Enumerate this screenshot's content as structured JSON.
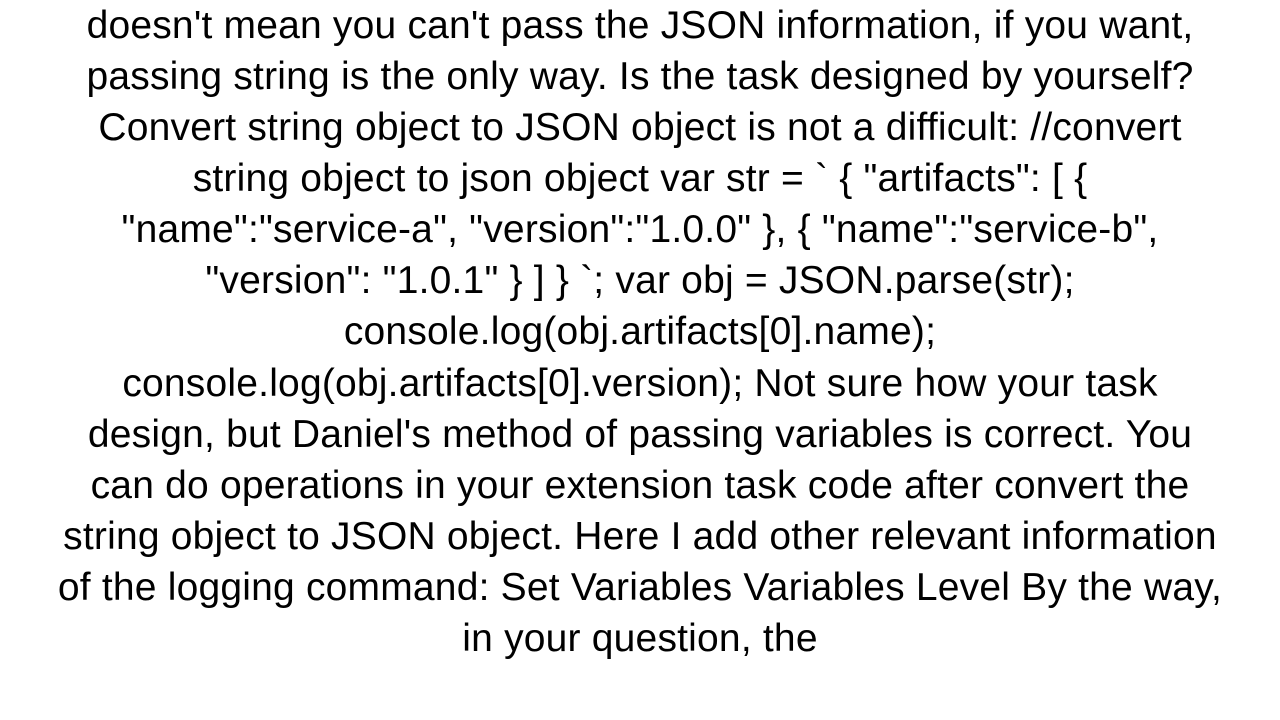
{
  "document": {
    "body_text": "doesn't mean you can't pass the JSON information, if you want, passing string is the only way. Is the task designed by yourself? Convert string object to JSON object is not a difficult: //convert string object to json object  var str = ` { \"artifacts\": [     {       \"name\":\"service-a\",       \"version\":\"1.0.0\"     },     {       \"name\":\"service-b\",       \"version\": \"1.0.1\"     }   ]   } `; var obj = JSON.parse(str); console.log(obj.artifacts[0].name); console.log(obj.artifacts[0].version);  Not sure how your task design, but Daniel's method of passing variables is correct. You can do operations in your extension task code after convert the string object to JSON object. Here I add other relevant information of the logging command: Set Variables Variables Level By the way, in your question, the"
  }
}
